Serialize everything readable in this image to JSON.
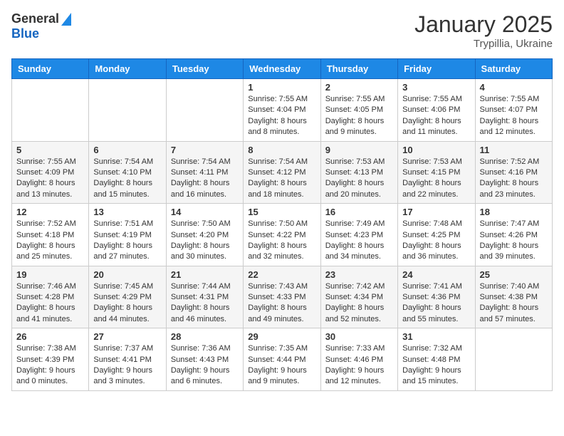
{
  "header": {
    "logo_general": "General",
    "logo_blue": "Blue",
    "month": "January 2025",
    "location": "Trypillia, Ukraine"
  },
  "columns": [
    "Sunday",
    "Monday",
    "Tuesday",
    "Wednesday",
    "Thursday",
    "Friday",
    "Saturday"
  ],
  "rows": [
    [
      {
        "day": "",
        "info": ""
      },
      {
        "day": "",
        "info": ""
      },
      {
        "day": "",
        "info": ""
      },
      {
        "day": "1",
        "info": "Sunrise: 7:55 AM\nSunset: 4:04 PM\nDaylight: 8 hours and 8 minutes."
      },
      {
        "day": "2",
        "info": "Sunrise: 7:55 AM\nSunset: 4:05 PM\nDaylight: 8 hours and 9 minutes."
      },
      {
        "day": "3",
        "info": "Sunrise: 7:55 AM\nSunset: 4:06 PM\nDaylight: 8 hours and 11 minutes."
      },
      {
        "day": "4",
        "info": "Sunrise: 7:55 AM\nSunset: 4:07 PM\nDaylight: 8 hours and 12 minutes."
      }
    ],
    [
      {
        "day": "5",
        "info": "Sunrise: 7:55 AM\nSunset: 4:09 PM\nDaylight: 8 hours and 13 minutes."
      },
      {
        "day": "6",
        "info": "Sunrise: 7:54 AM\nSunset: 4:10 PM\nDaylight: 8 hours and 15 minutes."
      },
      {
        "day": "7",
        "info": "Sunrise: 7:54 AM\nSunset: 4:11 PM\nDaylight: 8 hours and 16 minutes."
      },
      {
        "day": "8",
        "info": "Sunrise: 7:54 AM\nSunset: 4:12 PM\nDaylight: 8 hours and 18 minutes."
      },
      {
        "day": "9",
        "info": "Sunrise: 7:53 AM\nSunset: 4:13 PM\nDaylight: 8 hours and 20 minutes."
      },
      {
        "day": "10",
        "info": "Sunrise: 7:53 AM\nSunset: 4:15 PM\nDaylight: 8 hours and 22 minutes."
      },
      {
        "day": "11",
        "info": "Sunrise: 7:52 AM\nSunset: 4:16 PM\nDaylight: 8 hours and 23 minutes."
      }
    ],
    [
      {
        "day": "12",
        "info": "Sunrise: 7:52 AM\nSunset: 4:18 PM\nDaylight: 8 hours and 25 minutes."
      },
      {
        "day": "13",
        "info": "Sunrise: 7:51 AM\nSunset: 4:19 PM\nDaylight: 8 hours and 27 minutes."
      },
      {
        "day": "14",
        "info": "Sunrise: 7:50 AM\nSunset: 4:20 PM\nDaylight: 8 hours and 30 minutes."
      },
      {
        "day": "15",
        "info": "Sunrise: 7:50 AM\nSunset: 4:22 PM\nDaylight: 8 hours and 32 minutes."
      },
      {
        "day": "16",
        "info": "Sunrise: 7:49 AM\nSunset: 4:23 PM\nDaylight: 8 hours and 34 minutes."
      },
      {
        "day": "17",
        "info": "Sunrise: 7:48 AM\nSunset: 4:25 PM\nDaylight: 8 hours and 36 minutes."
      },
      {
        "day": "18",
        "info": "Sunrise: 7:47 AM\nSunset: 4:26 PM\nDaylight: 8 hours and 39 minutes."
      }
    ],
    [
      {
        "day": "19",
        "info": "Sunrise: 7:46 AM\nSunset: 4:28 PM\nDaylight: 8 hours and 41 minutes."
      },
      {
        "day": "20",
        "info": "Sunrise: 7:45 AM\nSunset: 4:29 PM\nDaylight: 8 hours and 44 minutes."
      },
      {
        "day": "21",
        "info": "Sunrise: 7:44 AM\nSunset: 4:31 PM\nDaylight: 8 hours and 46 minutes."
      },
      {
        "day": "22",
        "info": "Sunrise: 7:43 AM\nSunset: 4:33 PM\nDaylight: 8 hours and 49 minutes."
      },
      {
        "day": "23",
        "info": "Sunrise: 7:42 AM\nSunset: 4:34 PM\nDaylight: 8 hours and 52 minutes."
      },
      {
        "day": "24",
        "info": "Sunrise: 7:41 AM\nSunset: 4:36 PM\nDaylight: 8 hours and 55 minutes."
      },
      {
        "day": "25",
        "info": "Sunrise: 7:40 AM\nSunset: 4:38 PM\nDaylight: 8 hours and 57 minutes."
      }
    ],
    [
      {
        "day": "26",
        "info": "Sunrise: 7:38 AM\nSunset: 4:39 PM\nDaylight: 9 hours and 0 minutes."
      },
      {
        "day": "27",
        "info": "Sunrise: 7:37 AM\nSunset: 4:41 PM\nDaylight: 9 hours and 3 minutes."
      },
      {
        "day": "28",
        "info": "Sunrise: 7:36 AM\nSunset: 4:43 PM\nDaylight: 9 hours and 6 minutes."
      },
      {
        "day": "29",
        "info": "Sunrise: 7:35 AM\nSunset: 4:44 PM\nDaylight: 9 hours and 9 minutes."
      },
      {
        "day": "30",
        "info": "Sunrise: 7:33 AM\nSunset: 4:46 PM\nDaylight: 9 hours and 12 minutes."
      },
      {
        "day": "31",
        "info": "Sunrise: 7:32 AM\nSunset: 4:48 PM\nDaylight: 9 hours and 15 minutes."
      },
      {
        "day": "",
        "info": ""
      }
    ]
  ]
}
